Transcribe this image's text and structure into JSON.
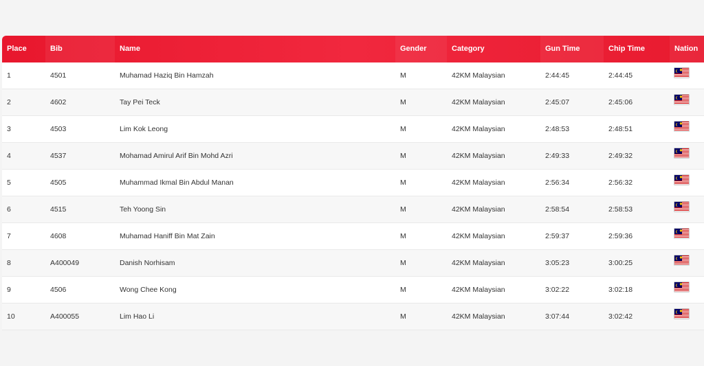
{
  "columns": [
    "Place",
    "Bib",
    "Name",
    "Gender",
    "Category",
    "Gun Time",
    "Chip Time",
    "Nation"
  ],
  "rows": [
    {
      "place": "1",
      "bib": "4501",
      "name": "Muhamad Haziq Bin Hamzah",
      "gender": "M",
      "category": "42KM Malaysian",
      "gun": "2:44:45",
      "chip": "2:44:45",
      "nation": "malaysia-flag-icon"
    },
    {
      "place": "2",
      "bib": "4602",
      "name": "Tay Pei Teck",
      "gender": "M",
      "category": "42KM Malaysian",
      "gun": "2:45:07",
      "chip": "2:45:06",
      "nation": "malaysia-flag-icon"
    },
    {
      "place": "3",
      "bib": "4503",
      "name": "Lim Kok Leong",
      "gender": "M",
      "category": "42KM Malaysian",
      "gun": "2:48:53",
      "chip": "2:48:51",
      "nation": "malaysia-flag-icon"
    },
    {
      "place": "4",
      "bib": "4537",
      "name": "Mohamad Amirul Arif Bin Mohd Azri",
      "gender": "M",
      "category": "42KM Malaysian",
      "gun": "2:49:33",
      "chip": "2:49:32",
      "nation": "malaysia-flag-icon"
    },
    {
      "place": "5",
      "bib": "4505",
      "name": "Muhammad Ikmal Bin Abdul Manan",
      "gender": "M",
      "category": "42KM Malaysian",
      "gun": "2:56:34",
      "chip": "2:56:32",
      "nation": "malaysia-flag-icon"
    },
    {
      "place": "6",
      "bib": "4515",
      "name": "Teh Yoong Sin",
      "gender": "M",
      "category": "42KM Malaysian",
      "gun": "2:58:54",
      "chip": "2:58:53",
      "nation": "malaysia-flag-icon"
    },
    {
      "place": "7",
      "bib": "4608",
      "name": "Muhamad Haniff Bin Mat Zain",
      "gender": "M",
      "category": "42KM Malaysian",
      "gun": "2:59:37",
      "chip": "2:59:36",
      "nation": "malaysia-flag-icon"
    },
    {
      "place": "8",
      "bib": "A400049",
      "name": "Danish Norhisam",
      "gender": "M",
      "category": "42KM Malaysian",
      "gun": "3:05:23",
      "chip": "3:00:25",
      "nation": "malaysia-flag-icon"
    },
    {
      "place": "9",
      "bib": "4506",
      "name": "Wong Chee Kong",
      "gender": "M",
      "category": "42KM Malaysian",
      "gun": "3:02:22",
      "chip": "3:02:18",
      "nation": "malaysia-flag-icon"
    },
    {
      "place": "10",
      "bib": "A400055",
      "name": "Lim Hao Li",
      "gender": "M",
      "category": "42KM Malaysian",
      "gun": "3:07:44",
      "chip": "3:02:42",
      "nation": "malaysia-flag-icon"
    }
  ],
  "colors": {
    "header": "#e8172d",
    "header_text": "#ffffff",
    "row_alt": "#f7f7f7"
  }
}
